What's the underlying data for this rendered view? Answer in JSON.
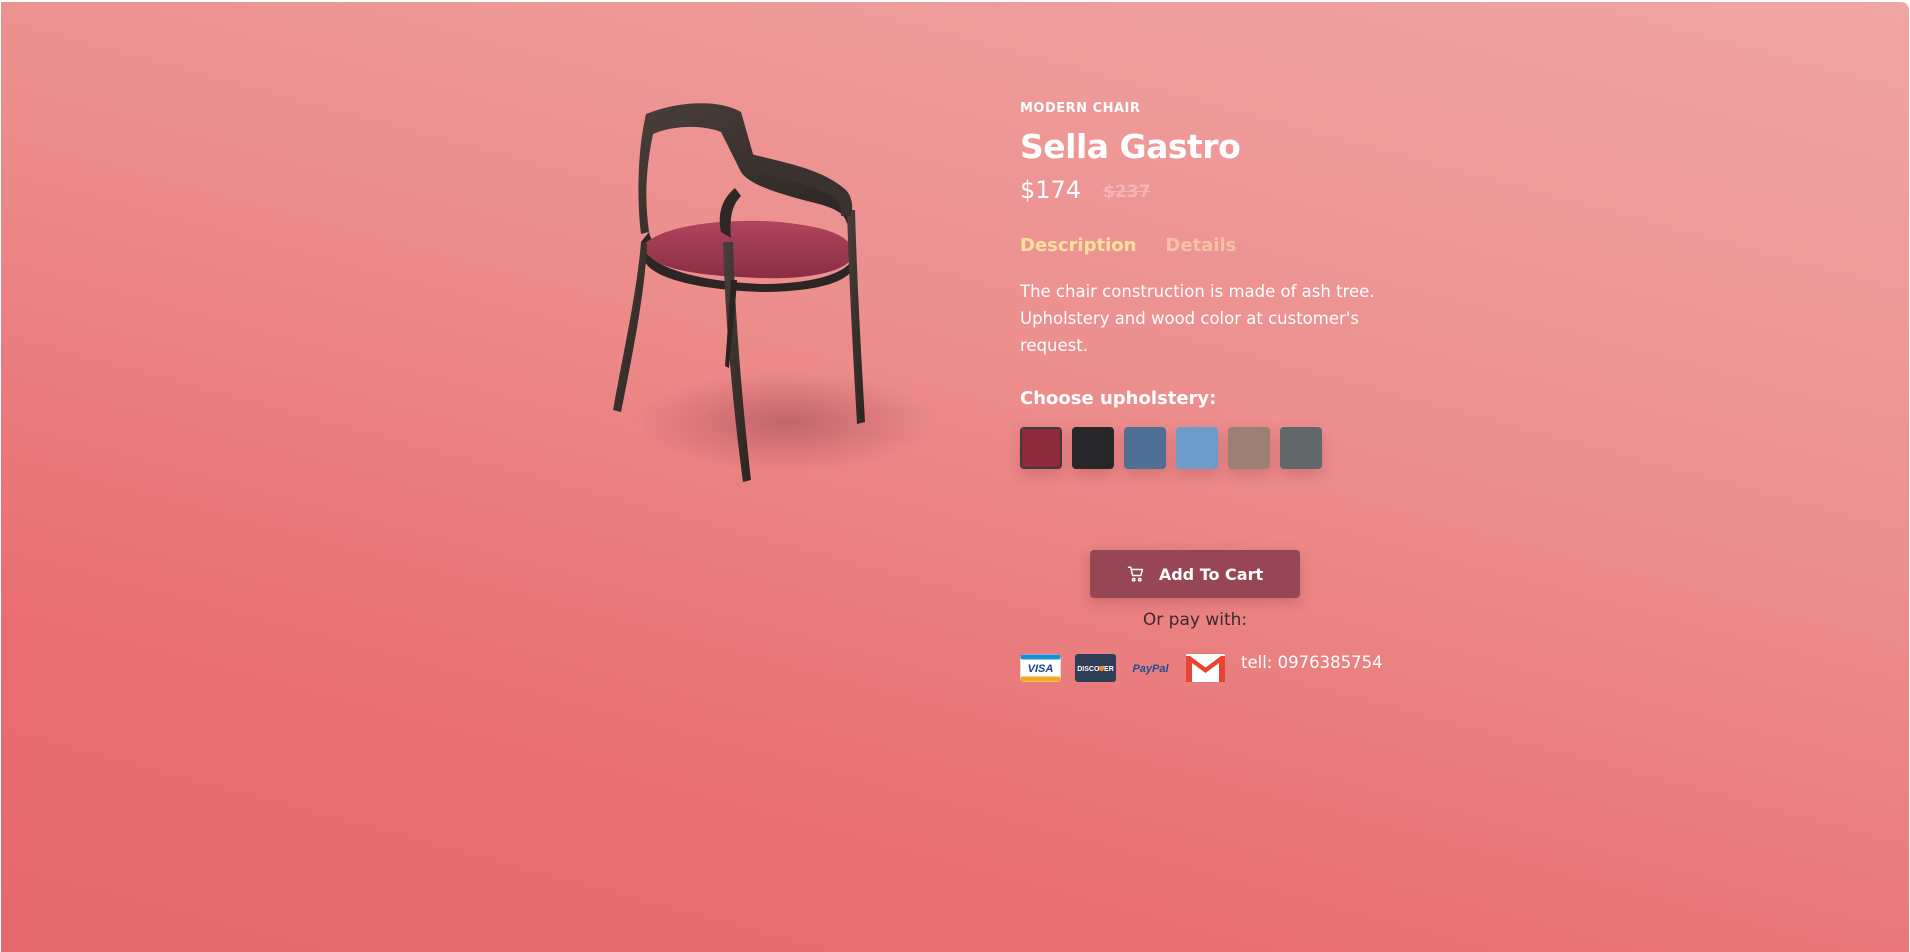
{
  "product": {
    "category": "MODERN CHAIR",
    "name": "Sella Gastro",
    "price": "$174",
    "old_price": "$237"
  },
  "tabs": {
    "description": "Description",
    "details": "Details"
  },
  "description_text": "The chair construction is made of ash tree. Upholstery and wood color at customer's request.",
  "upholstery": {
    "label": "Choose upholstery:",
    "options": [
      {
        "name": "red",
        "color": "#8e2a3d",
        "selected": true
      },
      {
        "name": "black",
        "color": "#27272a",
        "selected": false
      },
      {
        "name": "denim",
        "color": "#4f6f96",
        "selected": false
      },
      {
        "name": "light-blue",
        "color": "#6d9ccb",
        "selected": false
      },
      {
        "name": "taupe",
        "color": "#9c7f76",
        "selected": false
      },
      {
        "name": "grey-green",
        "color": "#61686a",
        "selected": false
      }
    ]
  },
  "cart": {
    "label": "Add To Cart",
    "icon": "cart-icon"
  },
  "pay_with_label": "Or pay with:",
  "payment_methods": [
    "visa",
    "discover",
    "paypal",
    "gmail"
  ],
  "payment_labels": {
    "visa": "VISA",
    "discover": "DISCOVER",
    "paypal": "PayPal"
  },
  "contact": "tell: 0976385754",
  "colors": {
    "accent_tab": "#fbe29b",
    "cart_button": "#974656",
    "background_top": "#f0a6a5",
    "background_bottom": "#e6696c"
  }
}
